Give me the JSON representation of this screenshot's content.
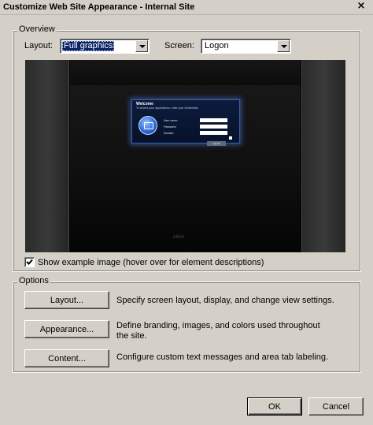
{
  "window": {
    "title": "Customize Web Site Appearance - Internal Site",
    "close_glyph": "×"
  },
  "overview": {
    "legend": "Overview",
    "layout_label": "Layout:",
    "layout_value": "Full graphics",
    "screen_label": "Screen:",
    "screen_value": "Logon",
    "preview": {
      "welcome": "Welcome",
      "subtitle": "To access your applications, enter your credentials.",
      "user_name": "User name:",
      "password": "Password:",
      "domain": "Domain:",
      "logon_button": "Log On",
      "brand": "citrix"
    },
    "show_example_label": "Show example image (hover over for element descriptions)",
    "show_example_checked": true
  },
  "options": {
    "legend": "Options",
    "items": [
      {
        "button": "Layout...",
        "description": "Specify screen layout, display, and change view settings."
      },
      {
        "button": "Appearance...",
        "description": "Define branding, images, and colors used throughout the site."
      },
      {
        "button": "Content...",
        "description": "Configure custom text messages and area tab labeling."
      }
    ]
  },
  "footer": {
    "ok": "OK",
    "cancel": "Cancel"
  },
  "colors": {
    "dialog_bg": "#d4d0c8",
    "selection": "#0a246a",
    "preview_glow": "#3b5da8"
  }
}
